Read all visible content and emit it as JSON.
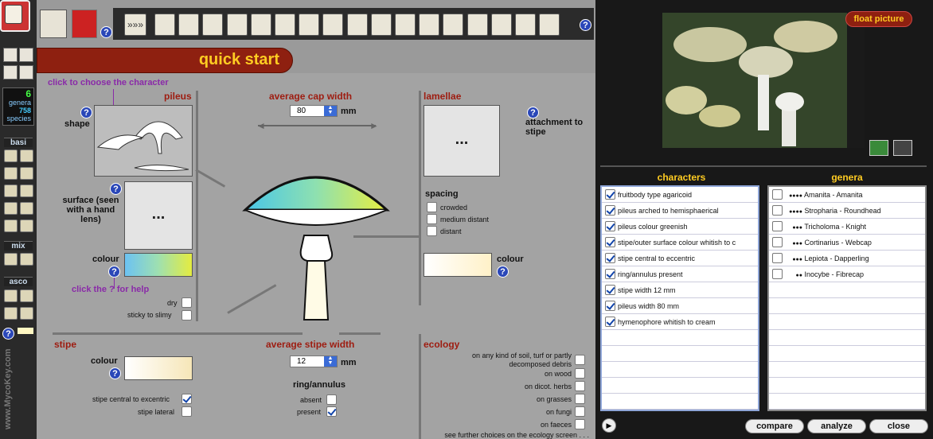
{
  "sidebar": {
    "counts": {
      "genera_num": "6",
      "genera_label": "genera",
      "species_num": "758",
      "species_label": "species"
    },
    "sections": [
      "basi",
      "mix",
      "asco"
    ],
    "watermark": "www.MycoKey.com"
  },
  "toolbar": {
    "forward_label": "»»»",
    "icons": [
      "stipe-icon",
      "cap-flat-icon",
      "cap-convex-icon",
      "cap-conical-icon",
      "bracket-icon",
      "tube-icon",
      "tube-icon",
      "skull-icon",
      "eye-icon",
      "gem-icon",
      "oval-icon",
      "oval-striped-icon",
      "oval-icon",
      "coral-icon",
      "coral-icon",
      "grid-icon",
      "grid-icon"
    ]
  },
  "banner": {
    "title": "quick start"
  },
  "pileus": {
    "heading": "pileus",
    "hint": "click to choose the character",
    "shape_label": "shape",
    "surface_label": "surface (seen with a hand lens)",
    "surface_value": "...",
    "colour_label": "colour",
    "help_hint": "click the ? for help",
    "dry": "dry",
    "sticky": "sticky to slimy"
  },
  "cap": {
    "heading": "average cap width",
    "value": "80",
    "unit": "mm"
  },
  "lamellae": {
    "heading": "lamellae",
    "value": "...",
    "attachment": "attachment to stipe",
    "spacing": "spacing",
    "options": [
      "crowded",
      "medium distant",
      "distant"
    ],
    "colour_label": "colour"
  },
  "stipe": {
    "heading": "stipe",
    "colour_label": "colour",
    "central": "stipe central to excentric",
    "lateral": "stipe lateral"
  },
  "stipe_width": {
    "heading": "average stipe width",
    "value": "12",
    "unit": "mm",
    "ring_heading": "ring/annulus",
    "absent": "absent",
    "present": "present"
  },
  "ecology": {
    "heading": "ecology",
    "items": [
      "on any kind of soil, turf or partly decomposed debris",
      "on wood",
      "on dicot. herbs",
      "on grasses",
      "on fungi",
      "on faeces"
    ],
    "more": "see further choices on the ecology screen . . ."
  },
  "right": {
    "float_label": "float picture",
    "characters_heading": "characters",
    "genera_heading": "genera",
    "characters": [
      "fruitbody type agaricoid",
      "pileus arched to hemisphaerical",
      "pileus colour greenish",
      "stipe/outer surface colour whitish to c",
      "stipe central to eccentric",
      "ring/annulus present",
      "stipe width 12 mm",
      "pileus width 80 mm",
      "hymenophore whitish to cream"
    ],
    "genera": [
      {
        "dots": "●●●●",
        "name": "Amanita - Amanita"
      },
      {
        "dots": "●●●●",
        "name": "Stropharia - Roundhead"
      },
      {
        "dots": "●●●",
        "name": "Tricholoma - Knight"
      },
      {
        "dots": "●●●",
        "name": "Cortinarius - Webcap"
      },
      {
        "dots": "●●●",
        "name": "Lepiota - Dapperling"
      },
      {
        "dots": "●●",
        "name": "Inocybe - Fibrecap"
      }
    ],
    "buttons": {
      "compare": "compare",
      "analyze": "analyze",
      "close": "close"
    }
  },
  "colors": {
    "accent": "#9e1c10",
    "banner": "#8e2010",
    "title": "#ffcc22",
    "link": "#8a2aa8"
  }
}
